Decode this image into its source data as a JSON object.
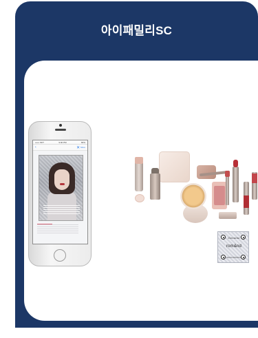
{
  "card": {
    "title": "아이패밀리SC",
    "background_color": "#1c3766"
  },
  "phone": {
    "statusbar": {
      "carrier": "•••••• SKT",
      "time": "9:40 PM",
      "battery": "82%"
    },
    "nav": {
      "back_icon": "chevron-left-icon",
      "close_icon": "close-icon",
      "more_label": "More"
    }
  },
  "sticker": {
    "script": "Genuine",
    "brand": "rom&nd",
    "code": "0000000000"
  },
  "icons": [
    "chevron-left-icon",
    "close-icon",
    "home-button-icon",
    "security-dot-icon"
  ]
}
